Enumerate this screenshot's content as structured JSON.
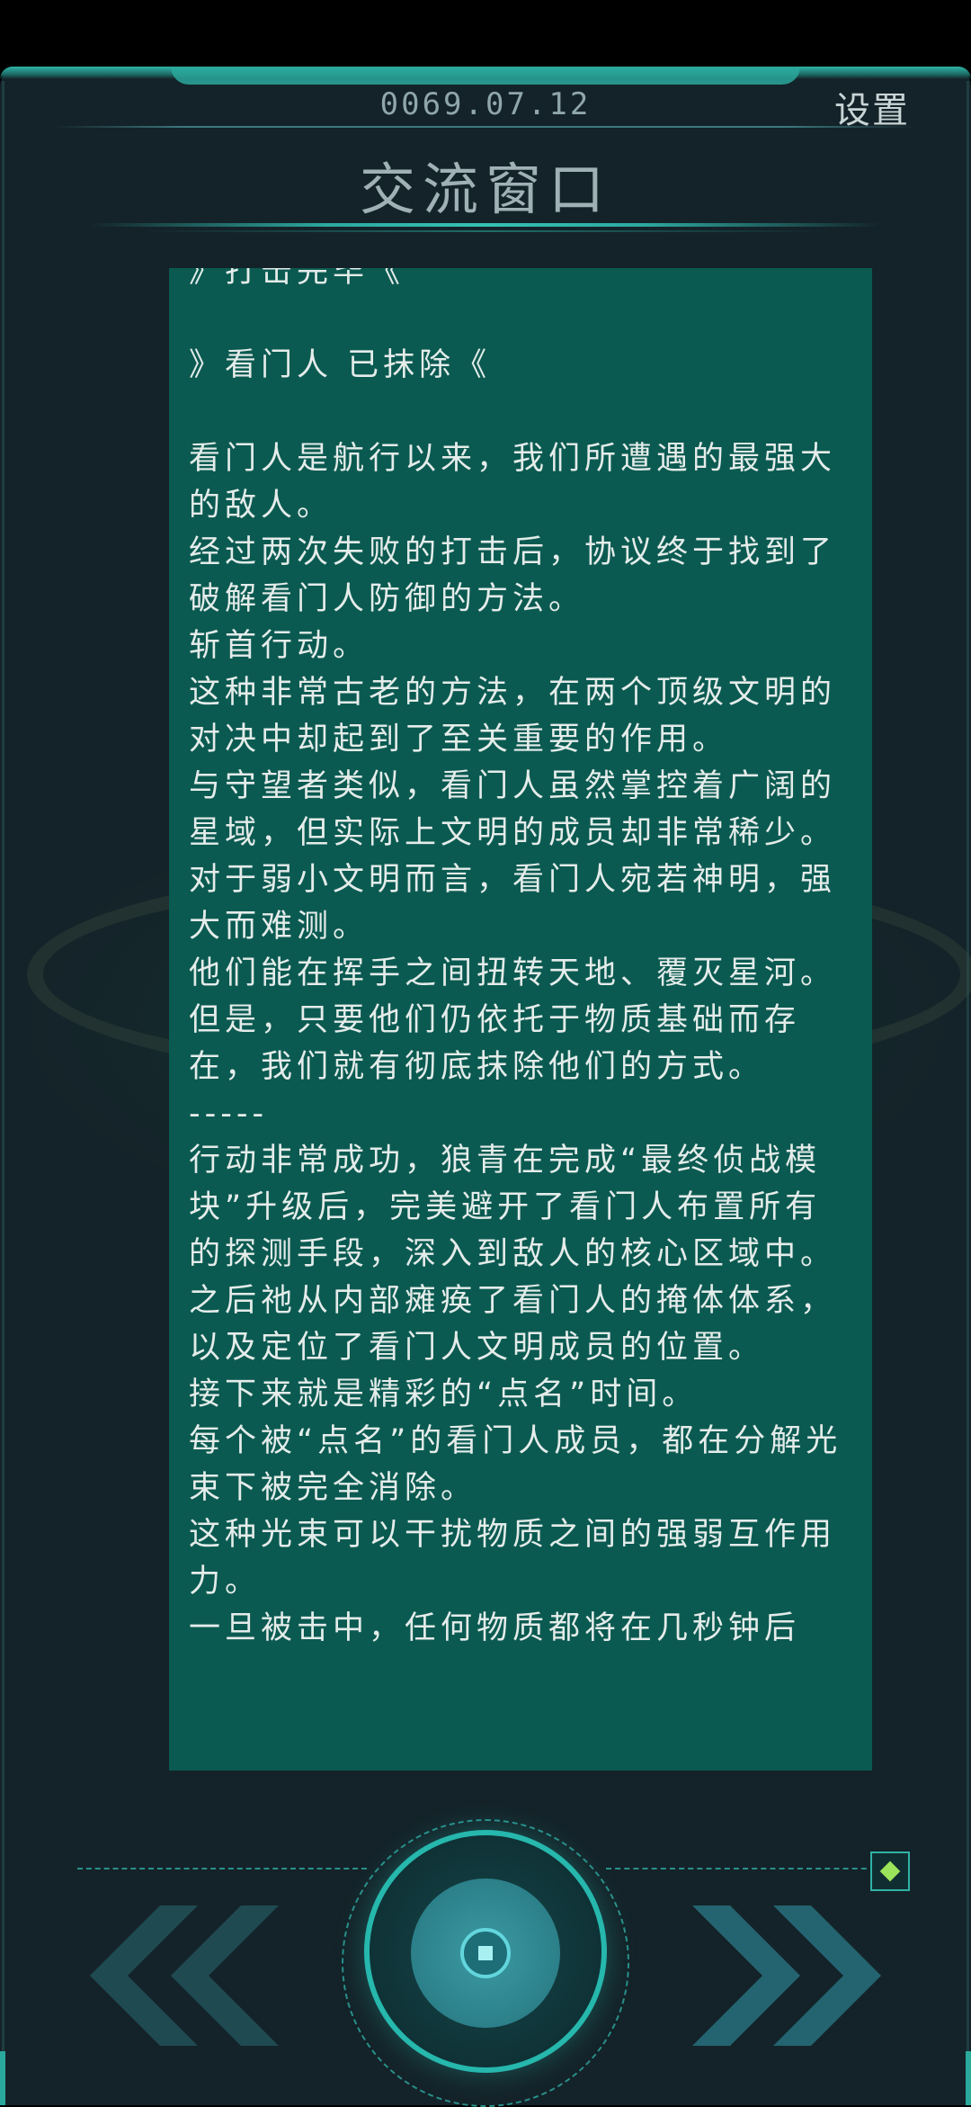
{
  "header": {
    "date": "0069.07.12",
    "settings_label": "设置",
    "title": "交流窗口"
  },
  "message": {
    "lines": [
      "》打击完毕《",
      "",
      "》看门人 已抹除《",
      "",
      "看门人是航行以来，我们所遭遇的最强大的敌人。",
      "经过两次失败的打击后，协议终于找到了破解看门人防御的方法。",
      "斩首行动。",
      "这种非常古老的方法，在两个顶级文明的对决中却起到了至关重要的作用。",
      "与守望者类似，看门人虽然掌控着广阔的星域，但实际上文明的成员却非常稀少。",
      "对于弱小文明而言，看门人宛若神明，强大而难测。",
      "他们能在挥手之间扭转天地、覆灭星河。",
      "但是，只要他们仍依托于物质基础而存在，我们就有彻底抹除他们的方式。",
      "-----",
      "行动非常成功，狼青在完成“最终侦战模块”升级后，完美避开了看门人布置所有的探测手段，深入到敌人的核心区域中。",
      "之后祂从内部瘫痪了看门人的掩体体系，以及定位了看门人文明成员的位置。",
      "接下来就是精彩的“点名”时间。",
      "每个被“点名”的看门人成员，都在分解光束下被完全消除。",
      "这种光束可以干扰物质之间的强弱互作用力。",
      "一旦被击中，任何物质都将在几秒钟后"
    ]
  },
  "controls": {
    "prev_icon": "double-chevron-left-icon",
    "next_icon": "double-chevron-right-icon",
    "center_icon": "center-action-icon",
    "gem_icon": "green-diamond-icon"
  },
  "colors": {
    "panel": "#0b5a51",
    "accent": "#26b7ad",
    "background": "#15292c"
  }
}
